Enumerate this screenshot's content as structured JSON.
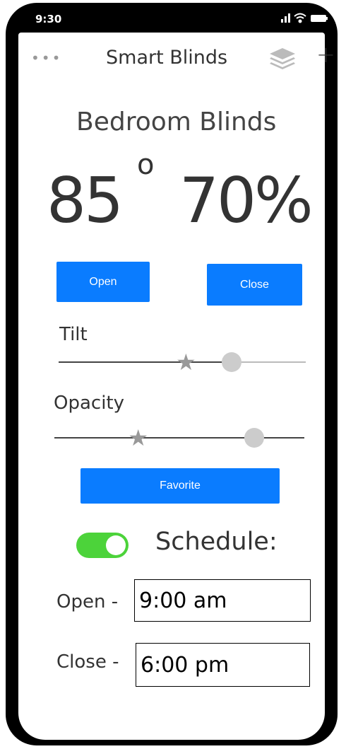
{
  "status_bar": {
    "time": "9:30",
    "icons": [
      "signal-icon",
      "wifi-icon",
      "battery-icon"
    ]
  },
  "header": {
    "title": "Smart Blinds",
    "more_icon": "more-icon",
    "layers_icon": "layers-icon",
    "add_label": "+"
  },
  "device": {
    "name": "Bedroom Blinds",
    "tilt_value": "85",
    "degree_symbol": "o",
    "opacity_value": "70%"
  },
  "buttons": {
    "open": "Open",
    "close": "Close",
    "favorite": "Favorite"
  },
  "sliders": {
    "tilt": {
      "label": "Tilt",
      "level": 0.7,
      "favorite_level": 0.52
    },
    "opacity": {
      "label": "Opacity",
      "level": 0.8,
      "favorite_level": 0.34
    }
  },
  "schedule": {
    "label": "Schedule:",
    "enabled": true,
    "open_label": "Open -",
    "open_time": "9:00 am",
    "close_label": "Close -",
    "close_time": "6:00 pm"
  },
  "colors": {
    "accent": "#0a7cff",
    "toggle_on": "#4cd33a",
    "thumb": "#cccccc",
    "star": "#999999"
  }
}
